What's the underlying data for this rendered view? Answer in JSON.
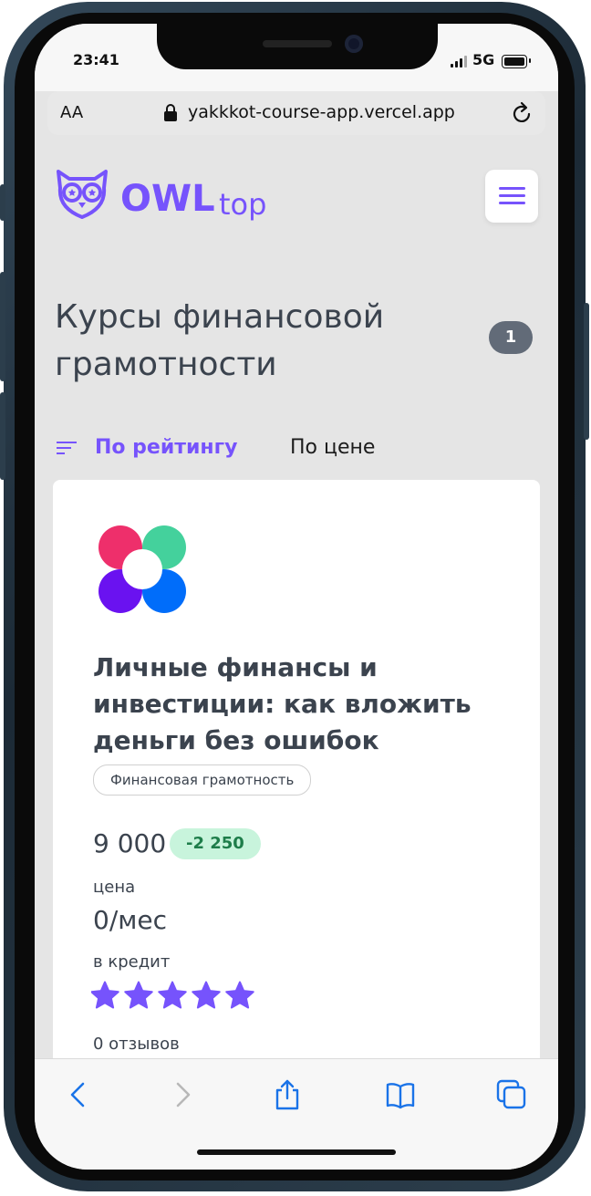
{
  "status": {
    "time": "23:41",
    "network": "5G"
  },
  "browser": {
    "text_size": "AA",
    "url": "yakkkot-course-app.vercel.app"
  },
  "header": {
    "brand": "OWL",
    "brand_sub": "top"
  },
  "page": {
    "title": "Курсы финансовой грамотности",
    "count": "1"
  },
  "sort": {
    "rating": "По рейтингу",
    "price": "По цене"
  },
  "course": {
    "title": "Личные финансы и инвестиции: как вложить деньги без ошибок",
    "tag": "Финансовая грамотность",
    "price": "9 000",
    "discount": "-2 250",
    "price_label": "цена",
    "credit": "0/мес",
    "credit_label": "в кредит",
    "rating": 5,
    "rating_max": 5,
    "reviews": "0 отзывов"
  },
  "colors": {
    "accent": "#7653fc",
    "text": "#3b434e",
    "discount_bg": "#c8f4dc",
    "discount_text": "#1e7d4a"
  }
}
